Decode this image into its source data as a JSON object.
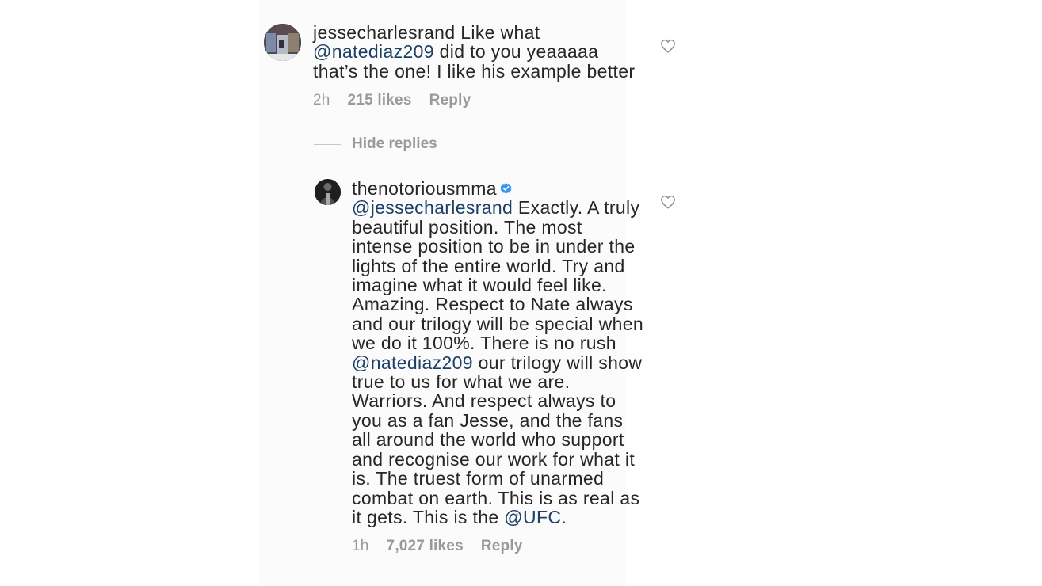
{
  "comments": [
    {
      "username": "jessecharlesrand",
      "text_parts": [
        {
          "type": "text",
          "value": " Like what "
        },
        {
          "type": "mention",
          "value": "@natediaz209"
        },
        {
          "type": "text",
          "value": " did to you yeaaaaa that’s the one! I like his example better"
        }
      ],
      "time": "2h",
      "likes": "215 likes",
      "reply_label": "Reply",
      "hide_replies_label": "Hide replies",
      "replies": [
        {
          "username": "thenotoriousmma",
          "verified": true,
          "text_parts": [
            {
              "type": "mention",
              "value": "@jessecharlesrand"
            },
            {
              "type": "text",
              "value": " Exactly. A truly beautiful position. The most intense position to be in under the lights of the entire world. Try and imagine what it would feel like. Amazing. Respect to Nate always and our trilogy will be special when we do it 100%. There is no rush "
            },
            {
              "type": "mention",
              "value": "@natediaz209"
            },
            {
              "type": "text",
              "value": " our trilogy will show true to us for what we are. Warriors. And respect always to you as a fan Jesse, and the fans all around the world who support and recognise our work for what it is. The truest form of unarmed combat on earth. This is as real as it gets. This is the "
            },
            {
              "type": "mention",
              "value": "@UFC"
            },
            {
              "type": "text",
              "value": "."
            }
          ],
          "time": "1h",
          "likes": "7,027 likes",
          "reply_label": "Reply"
        }
      ]
    }
  ],
  "icons": {
    "like": "heart-outline-icon",
    "verified": "verified-badge-icon"
  },
  "colors": {
    "text": "#262626",
    "mention": "#1c3f66",
    "meta": "#999999",
    "verified": "#3897f0"
  }
}
